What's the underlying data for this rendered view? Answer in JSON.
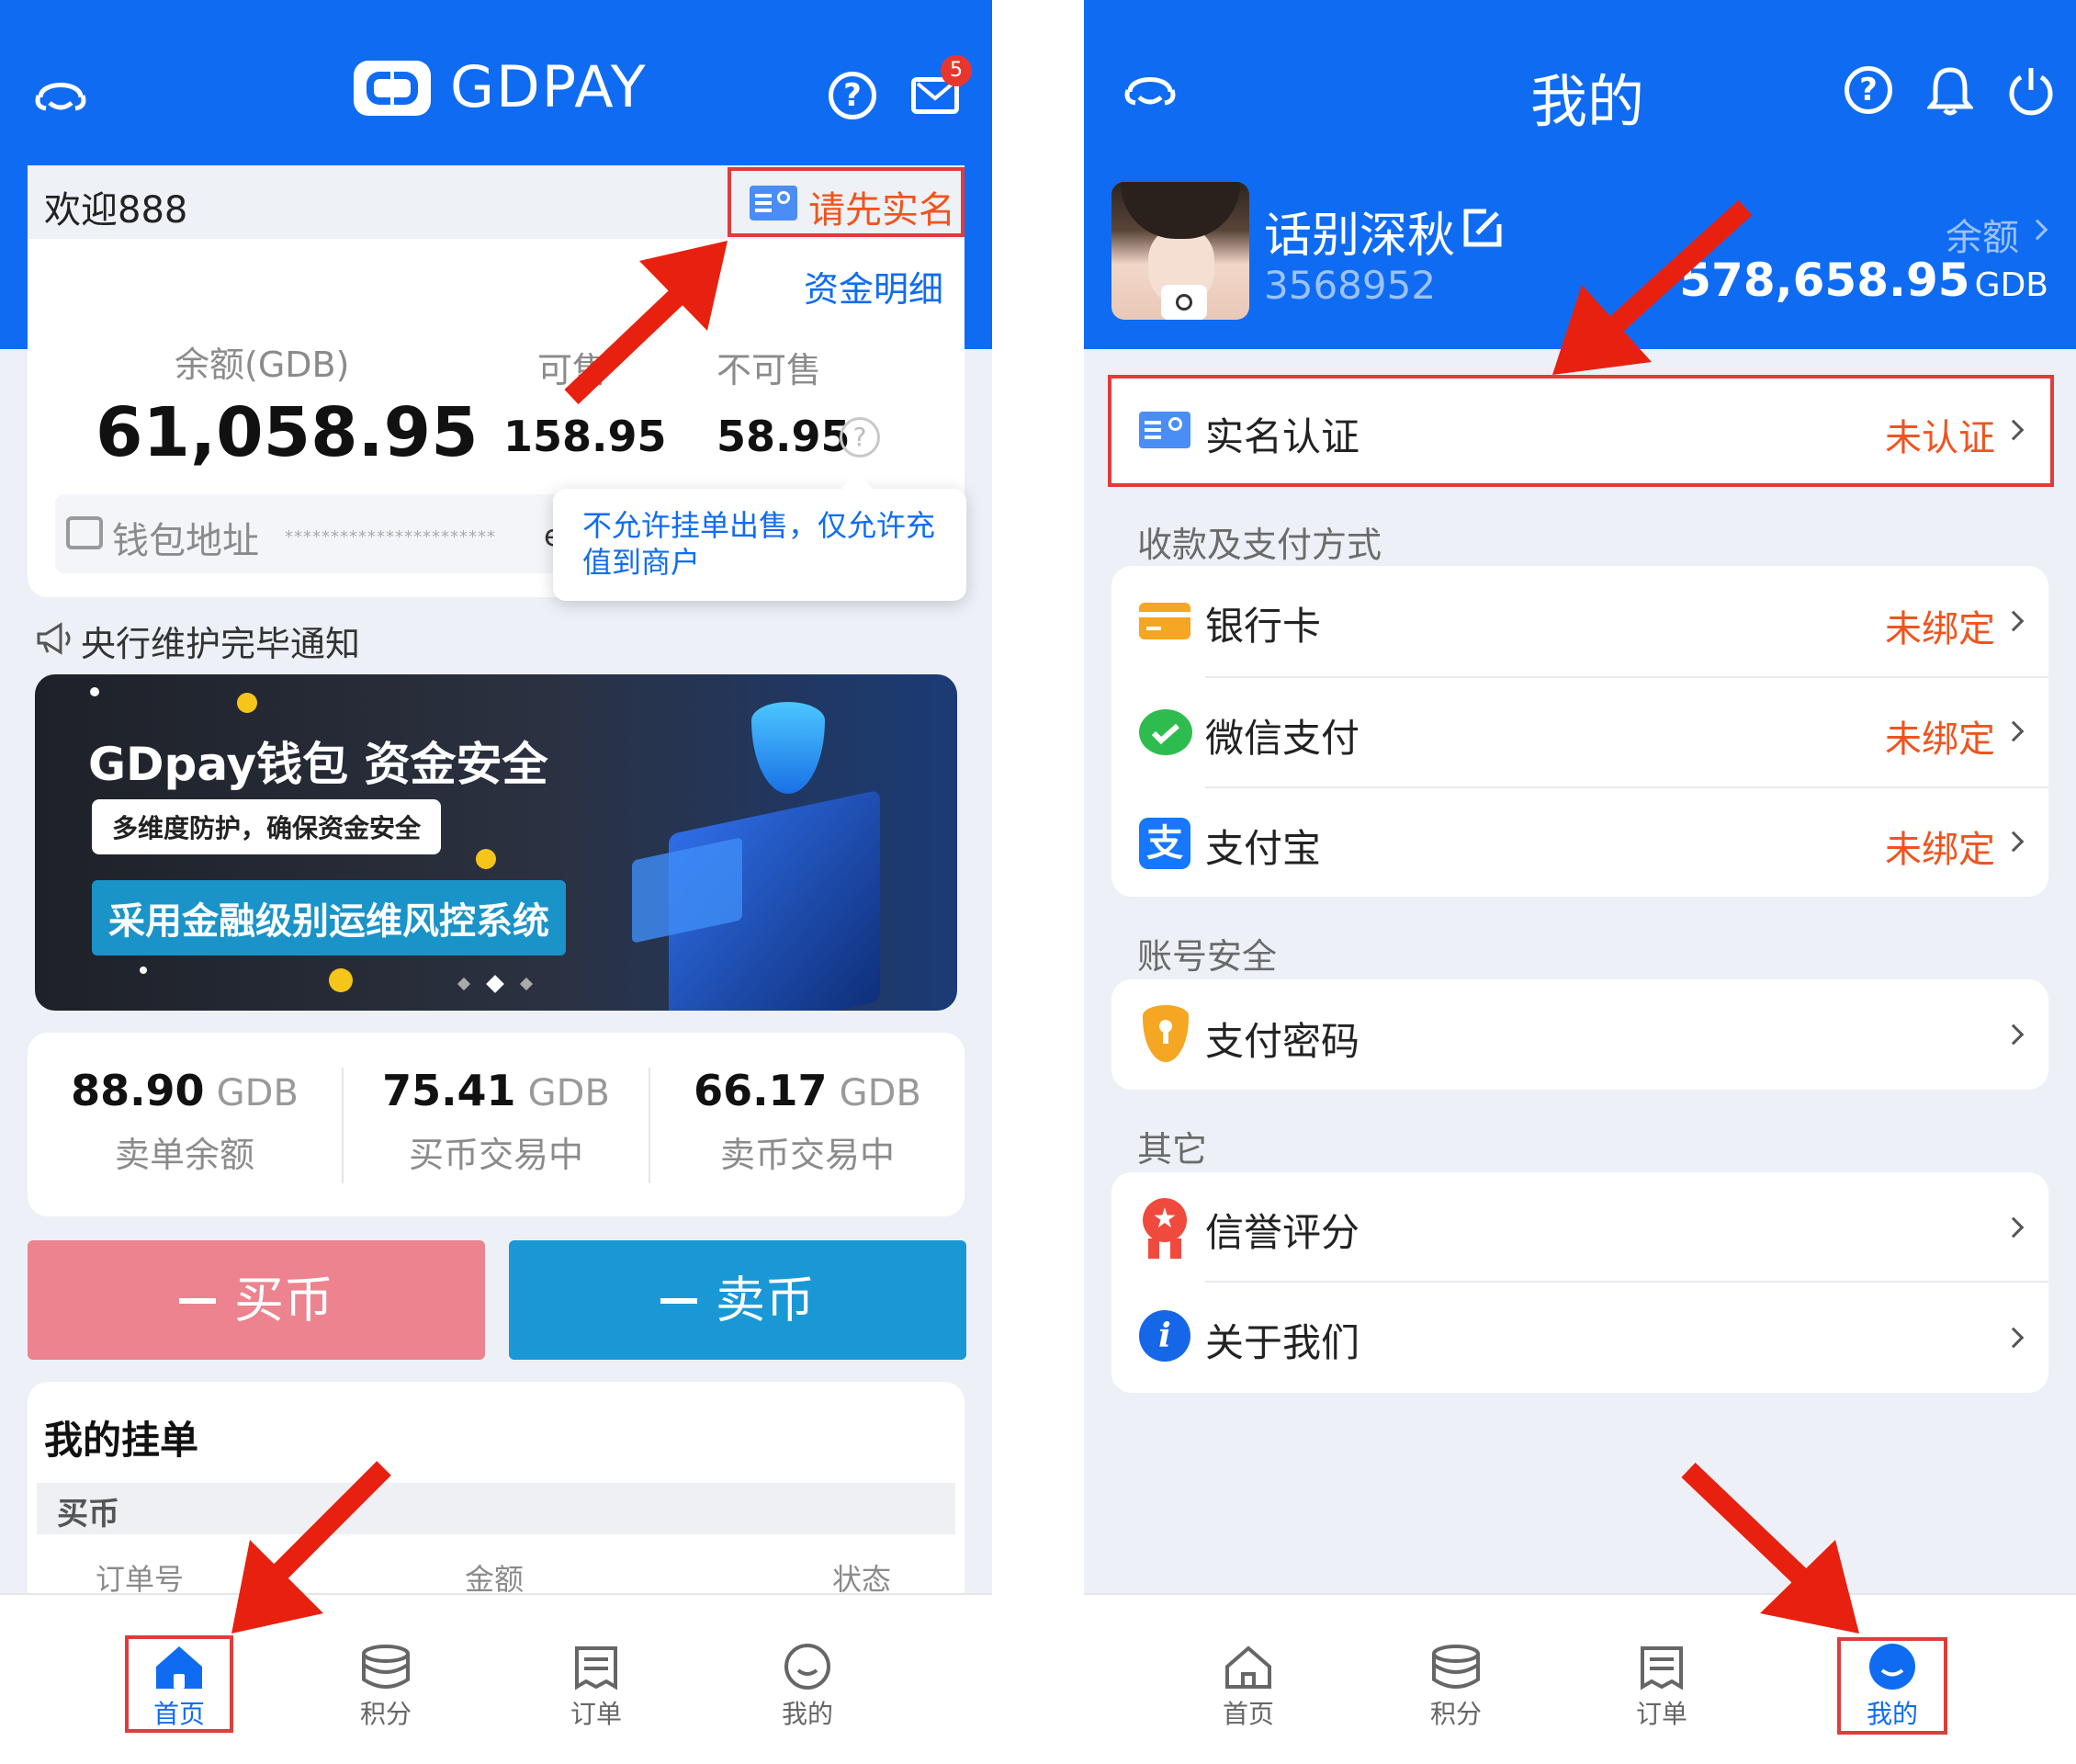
{
  "left": {
    "brand": "GDPAY",
    "badge_count": "5",
    "welcome": "欢迎888",
    "verify_label": "请先实名",
    "funds_detail": "资金明细",
    "balance": {
      "label": "余额(GDB)",
      "value": "61,058.95"
    },
    "sellable": {
      "label": "可售",
      "value": "158.95"
    },
    "unsellable": {
      "label": "不可售",
      "value": "58.95"
    },
    "tooltip": "不允许挂单出售，仅允许充值到商户",
    "wallet": {
      "label": "钱包地址",
      "masked": "***********************",
      "tail": "e"
    },
    "notice": "央行维护完毕通知",
    "banner": {
      "title": "GDpay钱包 资金安全",
      "sub": "多维度防护，确保资金安全",
      "tag": "采用金融级别运维风控系统"
    },
    "stats": [
      {
        "value": "88.90",
        "unit": "GDB",
        "label": "卖单余额"
      },
      {
        "value": "75.41",
        "unit": "GDB",
        "label": "买币交易中"
      },
      {
        "value": "66.17",
        "unit": "GDB",
        "label": "卖币交易中"
      }
    ],
    "buy_label": "买币",
    "sell_label": "卖币",
    "orders": {
      "title": "我的挂单",
      "tab": "买币",
      "cols": [
        "订单号",
        "金额",
        "状态"
      ]
    },
    "nav": [
      "首页",
      "积分",
      "订单",
      "我的"
    ]
  },
  "right": {
    "title": "我的",
    "user_name": "话别深秋",
    "user_id": "3568952",
    "balance_label": "余额",
    "balance_value": "578,658.95",
    "balance_unit": "GDB",
    "verify": {
      "label": "实名认证",
      "status": "未认证"
    },
    "section_pay": "收款及支付方式",
    "pay_items": [
      {
        "label": "银行卡",
        "status": "未绑定"
      },
      {
        "label": "微信支付",
        "status": "未绑定"
      },
      {
        "label": "支付宝",
        "status": "未绑定"
      }
    ],
    "section_security": "账号安全",
    "security_item": "支付密码",
    "section_other": "其它",
    "other_items": [
      "信誉评分",
      "关于我们"
    ],
    "nav": [
      "首页",
      "积分",
      "订单",
      "我的"
    ]
  },
  "colors": {
    "primary": "#0f6cf2",
    "orange": "#f0541e",
    "buy": "#ec838f",
    "sell": "#1a98d6",
    "bg": "#edf1f7"
  }
}
